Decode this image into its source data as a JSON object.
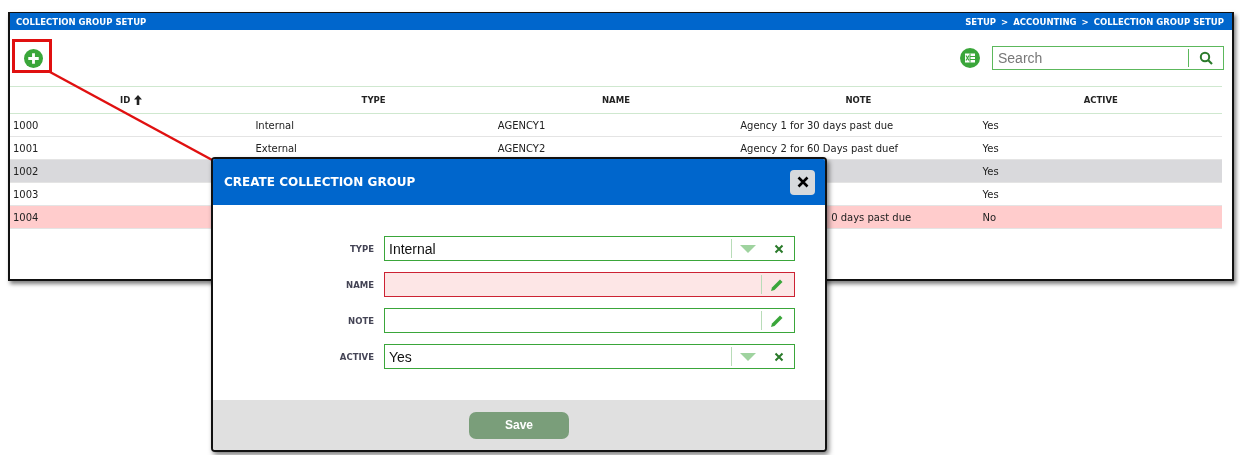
{
  "window": {
    "title": "COLLECTION GROUP SETUP",
    "breadcrumb": [
      "SETUP",
      ">",
      "ACCOUNTING",
      ">",
      "COLLECTION GROUP SETUP"
    ]
  },
  "toolbar": {
    "search": {
      "placeholder": "Search"
    }
  },
  "table": {
    "columns": [
      {
        "label": "ID",
        "sorted": true
      },
      {
        "label": "TYPE",
        "sorted": false
      },
      {
        "label": "NAME",
        "sorted": false
      },
      {
        "label": "NOTE",
        "sorted": false
      },
      {
        "label": "ACTIVE",
        "sorted": false
      }
    ],
    "rows": [
      {
        "cells": [
          "1000",
          "Internal",
          "AGENCY1",
          "Agency 1 for 30 days past due",
          "Yes"
        ],
        "selected": false,
        "inactive": false
      },
      {
        "cells": [
          "1001",
          "External",
          "AGENCY2",
          "Agency 2 for 60 Days past duef",
          "Yes"
        ],
        "selected": false,
        "inactive": false
      },
      {
        "cells": [
          "1002",
          "",
          "",
          "",
          "Yes"
        ],
        "selected": true,
        "inactive": false
      },
      {
        "cells": [
          "1003",
          "",
          "",
          "",
          "Yes"
        ],
        "selected": false,
        "inactive": false
      },
      {
        "cells": [
          "1004",
          "",
          "",
          "0 days past due",
          "No"
        ],
        "selected": false,
        "inactive": true,
        "note_cut": true
      }
    ]
  },
  "dialog": {
    "title": "CREATE COLLECTION GROUP",
    "fields": [
      {
        "label": "TYPE",
        "kind": "select",
        "value": "Internal",
        "invalid": false
      },
      {
        "label": "NAME",
        "kind": "text",
        "invalid": true
      },
      {
        "label": "NOTE",
        "kind": "text",
        "invalid": false
      },
      {
        "label": "ACTIVE",
        "kind": "select",
        "value": "Yes",
        "invalid": false
      }
    ],
    "save": "Save"
  }
}
